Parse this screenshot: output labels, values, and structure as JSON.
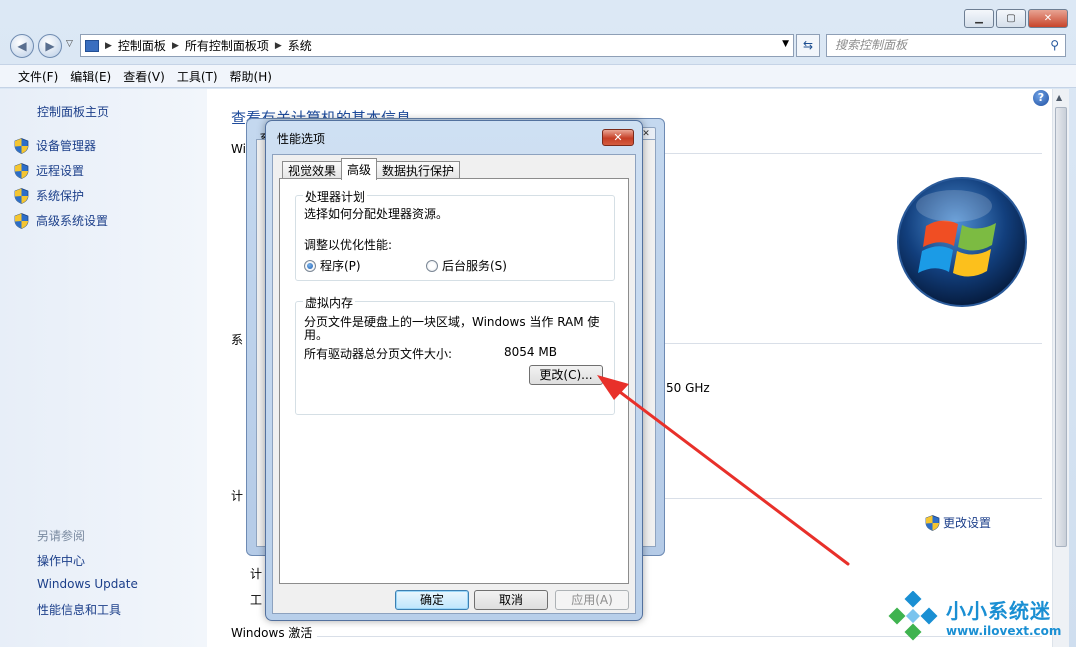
{
  "window": {
    "controls": {
      "minimize": "▁",
      "maximize": "▢",
      "close": "✕"
    },
    "breadcrumb": [
      "控制面板",
      "所有控制面板项",
      "系统"
    ],
    "search_placeholder": "搜索控制面板"
  },
  "menu": [
    "文件(F)",
    "编辑(E)",
    "查看(V)",
    "工具(T)",
    "帮助(H)"
  ],
  "left": {
    "home": "控制面板主页",
    "tasks": [
      "设备管理器",
      "远程设置",
      "系统保护",
      "高级系统设置"
    ],
    "see_also": "另请参阅",
    "links": [
      "操作中心",
      "Windows Update",
      "性能信息和工具"
    ]
  },
  "main": {
    "heading": "查看有关计算机的基本信息",
    "frag_win": "Wi",
    "frag_sys": "系",
    "frag_ghz": "50 GHz",
    "frag_calc": "计",
    "frag_calc2": "计",
    "frag_work": "工",
    "activation": "Windows 激活",
    "change_settings": "更改设置",
    "help": "?"
  },
  "sysprops": {
    "title": "系"
  },
  "perf": {
    "title": "性能选项",
    "close": "✕",
    "tabs": [
      "视觉效果",
      "高级",
      "数据执行保护"
    ],
    "processor": {
      "legend": "处理器计划",
      "desc": "选择如何分配处理器资源。",
      "adjust_label": "调整以优化性能:",
      "opt_programs": "程序(P)",
      "opt_background": "后台服务(S)"
    },
    "vm": {
      "legend": "虚拟内存",
      "desc_line1": "分页文件是硬盘上的一块区域，Windows 当作 RAM 使",
      "desc_line2": "用。",
      "total_label": "所有驱动器总分页文件大小:",
      "total_value": "8054 MB",
      "change_button": "更改(C)..."
    },
    "buttons": {
      "ok": "确定",
      "cancel": "取消",
      "apply": "应用(A)"
    }
  },
  "watermark": {
    "cn": "小小系统迷",
    "url": "www.ilovext.com"
  },
  "colors": {
    "accent_link": "#1c3f8a",
    "annotation_arrow": "#e8302a",
    "watermark": "#1a8fd3"
  }
}
